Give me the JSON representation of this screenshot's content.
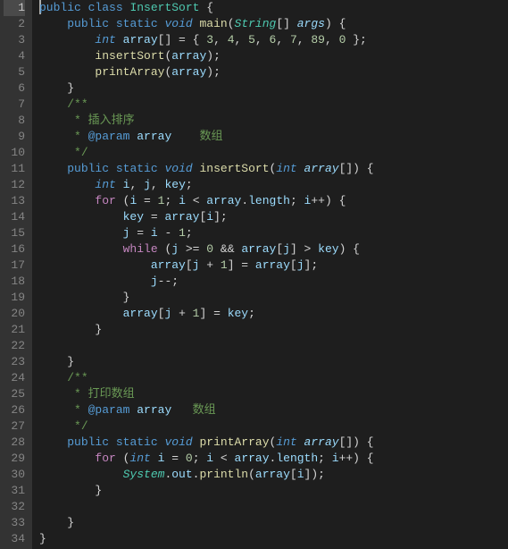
{
  "language": "java",
  "className": "InsertSort",
  "cursorLine": 1,
  "lines": [
    {
      "n": 1,
      "current": true,
      "cursor": true,
      "tokens": [
        [
          "kw",
          "public"
        ],
        [
          "pun",
          " "
        ],
        [
          "kw",
          "class"
        ],
        [
          "pun",
          " "
        ],
        [
          "type",
          "InsertSort"
        ],
        [
          "pun",
          " {"
        ]
      ]
    },
    {
      "n": 2,
      "tokens": [
        [
          "pun",
          "    "
        ],
        [
          "kw",
          "public"
        ],
        [
          "pun",
          " "
        ],
        [
          "kw",
          "static"
        ],
        [
          "pun",
          " "
        ],
        [
          "kw-i",
          "void"
        ],
        [
          "pun",
          " "
        ],
        [
          "fn",
          "main"
        ],
        [
          "pun",
          "("
        ],
        [
          "type-i",
          "String"
        ],
        [
          "pun",
          "[] "
        ],
        [
          "var-i",
          "args"
        ],
        [
          "pun",
          ") {"
        ]
      ]
    },
    {
      "n": 3,
      "tokens": [
        [
          "pun",
          "        "
        ],
        [
          "kw-i",
          "int"
        ],
        [
          "pun",
          " "
        ],
        [
          "var",
          "array"
        ],
        [
          "pun",
          "[] = { "
        ],
        [
          "num",
          "3"
        ],
        [
          "pun",
          ", "
        ],
        [
          "num",
          "4"
        ],
        [
          "pun",
          ", "
        ],
        [
          "num",
          "5"
        ],
        [
          "pun",
          ", "
        ],
        [
          "num",
          "6"
        ],
        [
          "pun",
          ", "
        ],
        [
          "num",
          "7"
        ],
        [
          "pun",
          ", "
        ],
        [
          "num",
          "89"
        ],
        [
          "pun",
          ", "
        ],
        [
          "num",
          "0"
        ],
        [
          "pun",
          " };"
        ]
      ]
    },
    {
      "n": 4,
      "tokens": [
        [
          "pun",
          "        "
        ],
        [
          "fn",
          "insertSort"
        ],
        [
          "pun",
          "("
        ],
        [
          "var",
          "array"
        ],
        [
          "pun",
          ");"
        ]
      ]
    },
    {
      "n": 5,
      "tokens": [
        [
          "pun",
          "        "
        ],
        [
          "fn",
          "printArray"
        ],
        [
          "pun",
          "("
        ],
        [
          "var",
          "array"
        ],
        [
          "pun",
          ");"
        ]
      ]
    },
    {
      "n": 6,
      "tokens": [
        [
          "pun",
          "    }"
        ]
      ]
    },
    {
      "n": 7,
      "tokens": [
        [
          "pun",
          "    "
        ],
        [
          "cmt",
          "/**"
        ]
      ]
    },
    {
      "n": 8,
      "tokens": [
        [
          "pun",
          "     "
        ],
        [
          "cmt",
          "* 插入排序"
        ]
      ]
    },
    {
      "n": 9,
      "tokens": [
        [
          "pun",
          "     "
        ],
        [
          "cmt",
          "* "
        ],
        [
          "doc",
          "@param"
        ],
        [
          "cmt",
          " "
        ],
        [
          "var",
          "array"
        ],
        [
          "cmt",
          "    数组"
        ]
      ]
    },
    {
      "n": 10,
      "tokens": [
        [
          "pun",
          "     "
        ],
        [
          "cmt",
          "*/"
        ]
      ]
    },
    {
      "n": 11,
      "tokens": [
        [
          "pun",
          "    "
        ],
        [
          "kw",
          "public"
        ],
        [
          "pun",
          " "
        ],
        [
          "kw",
          "static"
        ],
        [
          "pun",
          " "
        ],
        [
          "kw-i",
          "void"
        ],
        [
          "pun",
          " "
        ],
        [
          "fn",
          "insertSort"
        ],
        [
          "pun",
          "("
        ],
        [
          "kw-i",
          "int"
        ],
        [
          "pun",
          " "
        ],
        [
          "var-i",
          "array"
        ],
        [
          "pun",
          "[]) {"
        ]
      ]
    },
    {
      "n": 12,
      "tokens": [
        [
          "pun",
          "        "
        ],
        [
          "kw-i",
          "int"
        ],
        [
          "pun",
          " "
        ],
        [
          "var",
          "i"
        ],
        [
          "pun",
          ", "
        ],
        [
          "var",
          "j"
        ],
        [
          "pun",
          ", "
        ],
        [
          "var",
          "key"
        ],
        [
          "pun",
          ";"
        ]
      ]
    },
    {
      "n": 13,
      "tokens": [
        [
          "pun",
          "        "
        ],
        [
          "pk",
          "for"
        ],
        [
          "pun",
          " ("
        ],
        [
          "var",
          "i"
        ],
        [
          "pun",
          " = "
        ],
        [
          "num",
          "1"
        ],
        [
          "pun",
          "; "
        ],
        [
          "var",
          "i"
        ],
        [
          "pun",
          " < "
        ],
        [
          "var",
          "array"
        ],
        [
          "pun",
          "."
        ],
        [
          "var",
          "length"
        ],
        [
          "pun",
          "; "
        ],
        [
          "var",
          "i"
        ],
        [
          "pun",
          "++) {"
        ]
      ]
    },
    {
      "n": 14,
      "tokens": [
        [
          "pun",
          "            "
        ],
        [
          "var",
          "key"
        ],
        [
          "pun",
          " = "
        ],
        [
          "var",
          "array"
        ],
        [
          "pun",
          "["
        ],
        [
          "var",
          "i"
        ],
        [
          "pun",
          "];"
        ]
      ]
    },
    {
      "n": 15,
      "tokens": [
        [
          "pun",
          "            "
        ],
        [
          "var",
          "j"
        ],
        [
          "pun",
          " = "
        ],
        [
          "var",
          "i"
        ],
        [
          "pun",
          " - "
        ],
        [
          "num",
          "1"
        ],
        [
          "pun",
          ";"
        ]
      ]
    },
    {
      "n": 16,
      "tokens": [
        [
          "pun",
          "            "
        ],
        [
          "pk",
          "while"
        ],
        [
          "pun",
          " ("
        ],
        [
          "var",
          "j"
        ],
        [
          "pun",
          " >= "
        ],
        [
          "num",
          "0"
        ],
        [
          "pun",
          " && "
        ],
        [
          "var",
          "array"
        ],
        [
          "pun",
          "["
        ],
        [
          "var",
          "j"
        ],
        [
          "pun",
          "] > "
        ],
        [
          "var",
          "key"
        ],
        [
          "pun",
          ") {"
        ]
      ]
    },
    {
      "n": 17,
      "tokens": [
        [
          "pun",
          "                "
        ],
        [
          "var",
          "array"
        ],
        [
          "pun",
          "["
        ],
        [
          "var",
          "j"
        ],
        [
          "pun",
          " + "
        ],
        [
          "num",
          "1"
        ],
        [
          "pun",
          "] = "
        ],
        [
          "var",
          "array"
        ],
        [
          "pun",
          "["
        ],
        [
          "var",
          "j"
        ],
        [
          "pun",
          "];"
        ]
      ]
    },
    {
      "n": 18,
      "tokens": [
        [
          "pun",
          "                "
        ],
        [
          "var",
          "j"
        ],
        [
          "pun",
          "--;"
        ]
      ]
    },
    {
      "n": 19,
      "tokens": [
        [
          "pun",
          "            }"
        ]
      ]
    },
    {
      "n": 20,
      "tokens": [
        [
          "pun",
          "            "
        ],
        [
          "var",
          "array"
        ],
        [
          "pun",
          "["
        ],
        [
          "var",
          "j"
        ],
        [
          "pun",
          " + "
        ],
        [
          "num",
          "1"
        ],
        [
          "pun",
          "] = "
        ],
        [
          "var",
          "key"
        ],
        [
          "pun",
          ";"
        ]
      ]
    },
    {
      "n": 21,
      "tokens": [
        [
          "pun",
          "        }"
        ]
      ]
    },
    {
      "n": 22,
      "tokens": [
        [
          "pun",
          ""
        ]
      ]
    },
    {
      "n": 23,
      "tokens": [
        [
          "pun",
          "    }"
        ]
      ]
    },
    {
      "n": 24,
      "tokens": [
        [
          "pun",
          "    "
        ],
        [
          "cmt",
          "/**"
        ]
      ]
    },
    {
      "n": 25,
      "tokens": [
        [
          "pun",
          "     "
        ],
        [
          "cmt",
          "* 打印数组"
        ]
      ]
    },
    {
      "n": 26,
      "tokens": [
        [
          "pun",
          "     "
        ],
        [
          "cmt",
          "* "
        ],
        [
          "doc",
          "@param"
        ],
        [
          "cmt",
          " "
        ],
        [
          "var",
          "array"
        ],
        [
          "cmt",
          "   数组"
        ]
      ]
    },
    {
      "n": 27,
      "tokens": [
        [
          "pun",
          "     "
        ],
        [
          "cmt",
          "*/"
        ]
      ]
    },
    {
      "n": 28,
      "tokens": [
        [
          "pun",
          "    "
        ],
        [
          "kw",
          "public"
        ],
        [
          "pun",
          " "
        ],
        [
          "kw",
          "static"
        ],
        [
          "pun",
          " "
        ],
        [
          "kw-i",
          "void"
        ],
        [
          "pun",
          " "
        ],
        [
          "fn",
          "printArray"
        ],
        [
          "pun",
          "("
        ],
        [
          "kw-i",
          "int"
        ],
        [
          "pun",
          " "
        ],
        [
          "var-i",
          "array"
        ],
        [
          "pun",
          "[]) {"
        ]
      ]
    },
    {
      "n": 29,
      "tokens": [
        [
          "pun",
          "        "
        ],
        [
          "pk",
          "for"
        ],
        [
          "pun",
          " ("
        ],
        [
          "kw-i",
          "int"
        ],
        [
          "pun",
          " "
        ],
        [
          "var",
          "i"
        ],
        [
          "pun",
          " = "
        ],
        [
          "num",
          "0"
        ],
        [
          "pun",
          "; "
        ],
        [
          "var",
          "i"
        ],
        [
          "pun",
          " < "
        ],
        [
          "var",
          "array"
        ],
        [
          "pun",
          "."
        ],
        [
          "var",
          "length"
        ],
        [
          "pun",
          "; "
        ],
        [
          "var",
          "i"
        ],
        [
          "pun",
          "++) {"
        ]
      ]
    },
    {
      "n": 30,
      "tokens": [
        [
          "pun",
          "            "
        ],
        [
          "type-i",
          "System"
        ],
        [
          "pun",
          "."
        ],
        [
          "var",
          "out"
        ],
        [
          "pun",
          "."
        ],
        [
          "fn",
          "println"
        ],
        [
          "pun",
          "("
        ],
        [
          "var",
          "array"
        ],
        [
          "pun",
          "["
        ],
        [
          "var",
          "i"
        ],
        [
          "pun",
          "]);"
        ]
      ]
    },
    {
      "n": 31,
      "tokens": [
        [
          "pun",
          "        }"
        ]
      ]
    },
    {
      "n": 32,
      "tokens": [
        [
          "pun",
          ""
        ]
      ]
    },
    {
      "n": 33,
      "tokens": [
        [
          "pun",
          "    }"
        ]
      ]
    },
    {
      "n": 34,
      "tokens": [
        [
          "pun",
          "}"
        ]
      ]
    }
  ]
}
